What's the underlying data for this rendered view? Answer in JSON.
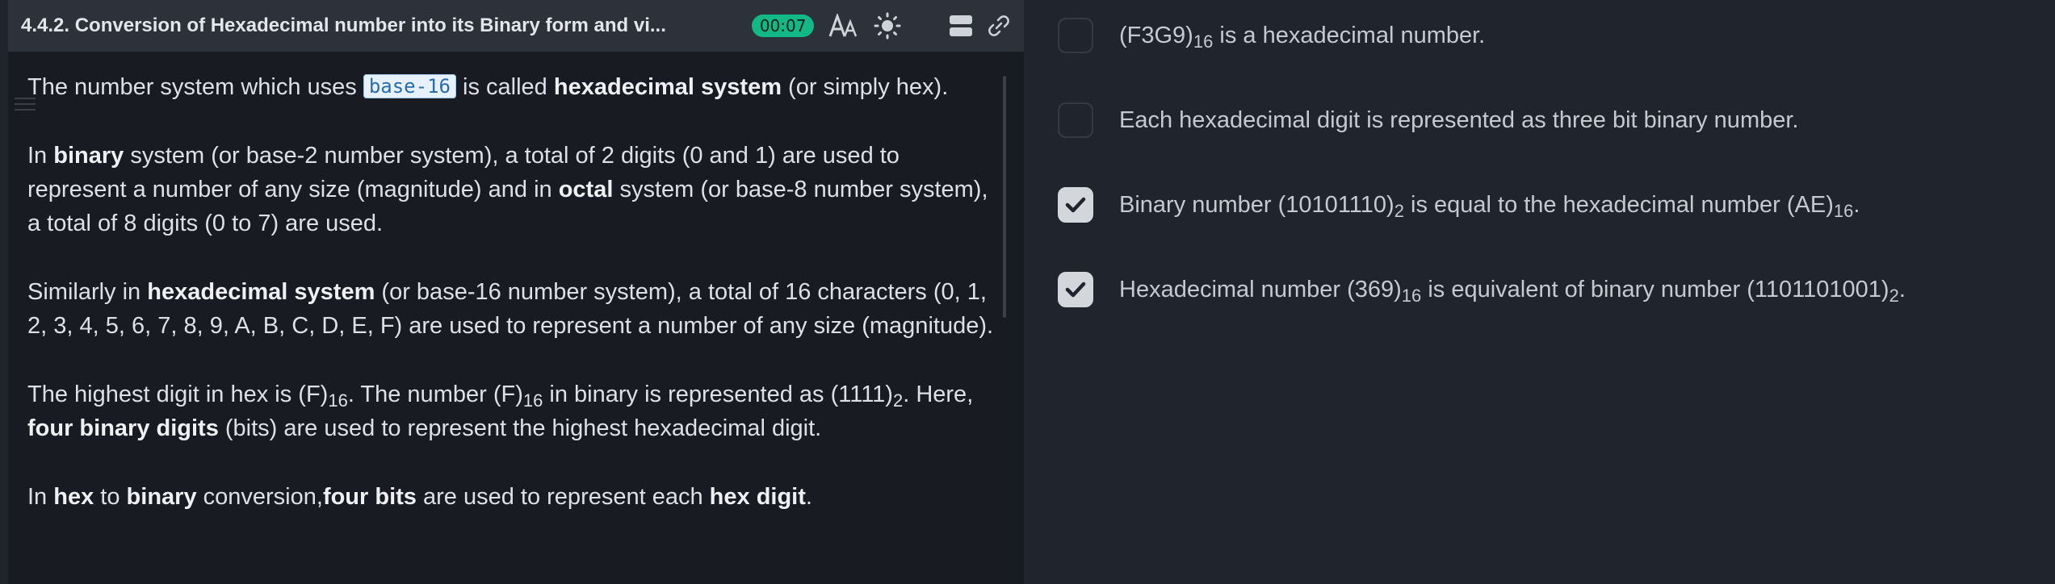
{
  "header": {
    "title": "4.4.2. Conversion of Hexadecimal number into its Binary form and vi...",
    "timer": "00:07",
    "icons": [
      "font-size-icon",
      "theme-sun-icon",
      "layout-toggle-icon",
      "link-icon"
    ]
  },
  "content": {
    "p1": {
      "a": "The number system which uses ",
      "code": "base-16",
      "b": " is called ",
      "bold": "hexadecimal system",
      "c": " (or simply hex)."
    },
    "p2": {
      "a": "In ",
      "bold1": "binary",
      "b": " system (or base-2 number system), a total of 2 digits (0 and 1) are used to represent a number of any size (magnitude) and in ",
      "bold2": "octal",
      "c": " system (or base-8 number system), a total of 8 digits (0 to 7) are used."
    },
    "p3": {
      "a": "Similarly in ",
      "bold": "hexadecimal system",
      "b": " (or base-16 number system), a total of 16 characters (0, 1, 2, 3, 4, 5, 6, 7, 8, 9, A, B, C, D, E, F) are used to represent a number of any size (magnitude)."
    },
    "p4": {
      "a": "The highest digit in hex is (F)",
      "sub1": "16",
      "b": ". The number (F)",
      "sub2": "16",
      "c": " in binary is represented as (1111)",
      "sub3": "2",
      "d": ". Here, ",
      "bold": "four binary digits",
      "e": " (bits) are used to represent the highest hexadecimal digit."
    },
    "p5": {
      "a": "In ",
      "bold1": "hex",
      "b": " to ",
      "bold2": "binary",
      "c": " conversion,",
      "bold3": "four bits",
      "d": " are used to represent each ",
      "bold4": "hex digit",
      "e": "."
    }
  },
  "options": [
    {
      "checked": false,
      "pre": "(F3G9)",
      "sub": "16",
      "post": " is a hexadecimal number."
    },
    {
      "checked": false,
      "text": "Each hexadecimal digit is represented as three bit binary number."
    },
    {
      "checked": true,
      "pre": "Binary number (10101110)",
      "sub1": "2",
      "mid": " is equal to the hexadecimal number (AE)",
      "sub2": "16",
      "post": "."
    },
    {
      "checked": true,
      "pre": "Hexadecimal number (369)",
      "sub1": "16",
      "mid": " is equivalent of binary number (1101101001)",
      "sub2": "2",
      "post": "."
    }
  ],
  "colors": {
    "accent_timer": "#12b886",
    "panel_left": "#181b21",
    "panel_right": "#1f242d",
    "header": "#2d3139"
  }
}
